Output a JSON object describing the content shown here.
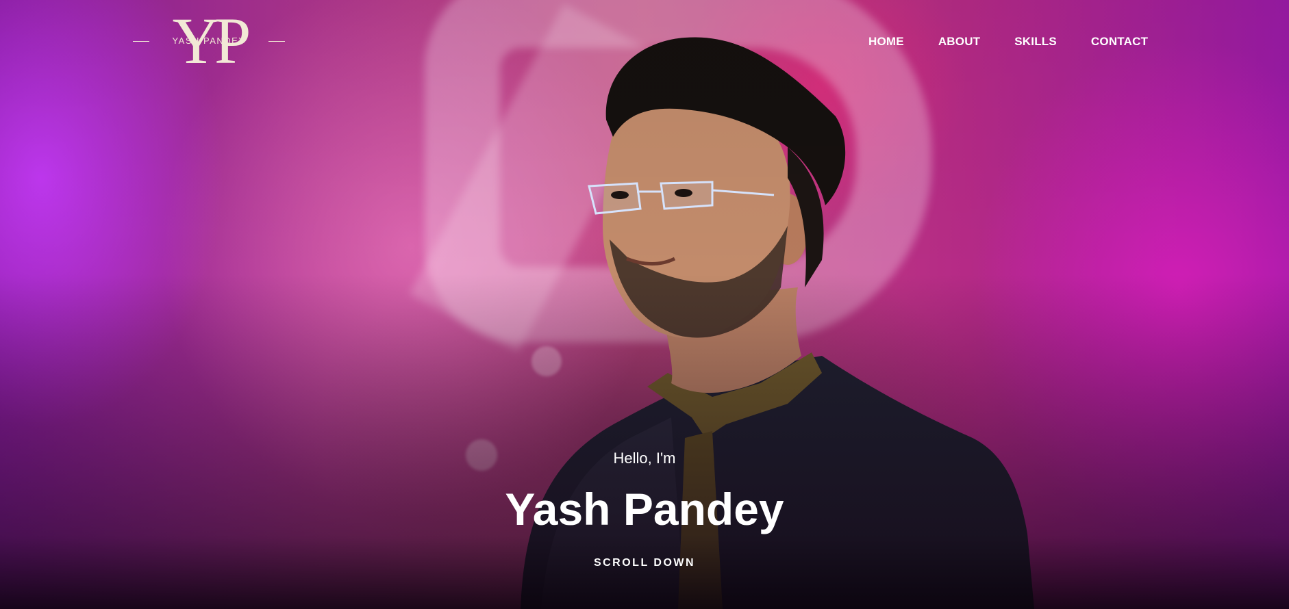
{
  "brand": {
    "monogram": "YP",
    "name": "YASH PANDEY"
  },
  "nav": {
    "items": [
      {
        "label": "HOME"
      },
      {
        "label": "ABOUT"
      },
      {
        "label": "SKILLS"
      },
      {
        "label": "CONTACT"
      }
    ]
  },
  "hero": {
    "greeting": "Hello, I'm",
    "name": "Yash Pandey",
    "scroll_label": "SCROLL DOWN",
    "image": "portrait-photo"
  },
  "colors": {
    "text": "#ffffff",
    "logo": "#f2e9d6",
    "background_accent": "#c2477d"
  }
}
